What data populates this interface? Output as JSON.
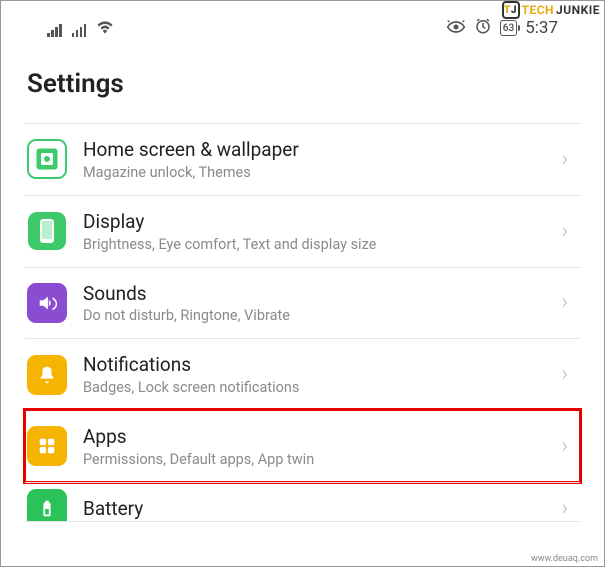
{
  "watermark": {
    "brand1": "TECH",
    "brand2": "JUNKIE",
    "bottom": "www.deuaq.com"
  },
  "statusbar": {
    "battery_pct": "63",
    "time": "5:37"
  },
  "page_title": "Settings",
  "rows": [
    {
      "title": "Home screen & wallpaper",
      "subtitle": "Magazine unlock, Themes"
    },
    {
      "title": "Display",
      "subtitle": "Brightness, Eye comfort, Text and display size"
    },
    {
      "title": "Sounds",
      "subtitle": "Do not disturb, Ringtone, Vibrate"
    },
    {
      "title": "Notifications",
      "subtitle": "Badges, Lock screen notifications"
    },
    {
      "title": "Apps",
      "subtitle": "Permissions, Default apps, App twin"
    },
    {
      "title": "Battery",
      "subtitle": ""
    }
  ]
}
